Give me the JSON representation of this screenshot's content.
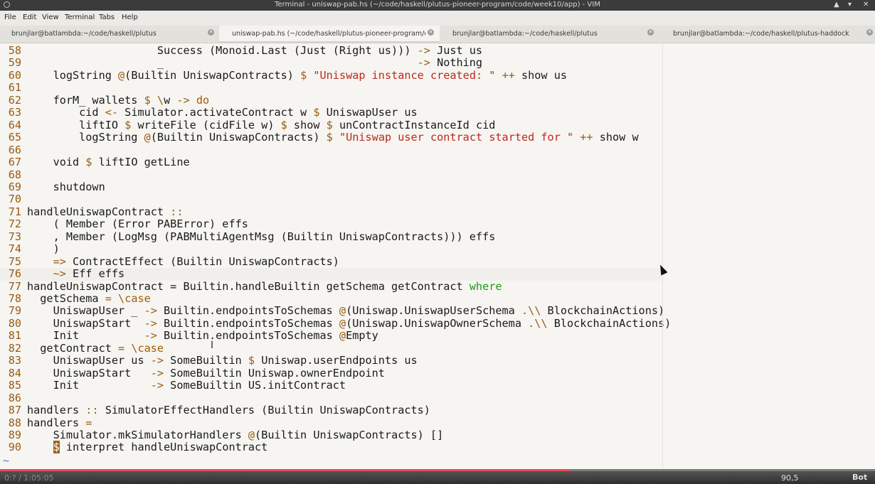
{
  "window": {
    "title": "Terminal - uniswap-pab.hs (~/code/haskell/plutus-pioneer-program/code/week10/app) - VIM",
    "controls": [
      "▲",
      "▾",
      "✕"
    ]
  },
  "menu": [
    "File",
    "Edit",
    "View",
    "Terminal",
    "Tabs",
    "Help"
  ],
  "tabs": [
    {
      "label": "brunjlar@batlambda:~/code/haskell/plutus"
    },
    {
      "label": "uniswap-pab.hs (~/code/haskell/plutus-pioneer-program/c..."
    },
    {
      "label": "brunjlar@batlambda:~/code/haskell/plutus"
    },
    {
      "label": "brunjlar@batlambda:~/code/haskell/plutus-haddock"
    }
  ],
  "editor": {
    "lines": [
      {
        "n": "58",
        "tokens": [
          [
            "",
            "                    Success (Monoid.Last (Just (Right us))) "
          ],
          [
            "op",
            "->"
          ],
          [
            "",
            " Just us"
          ]
        ]
      },
      {
        "n": "59",
        "tokens": [
          [
            "",
            "                    _                                       "
          ],
          [
            "op",
            "->"
          ],
          [
            "",
            " Nothing"
          ]
        ]
      },
      {
        "n": "60",
        "tokens": [
          [
            "",
            "    logString "
          ],
          [
            "op",
            "@"
          ],
          [
            "",
            "(Builtin UniswapContracts) "
          ],
          [
            "op",
            "$"
          ],
          [
            "",
            " "
          ],
          [
            "str",
            "\"Uniswap instance created: \""
          ],
          [
            "",
            " "
          ],
          [
            "op",
            "++"
          ],
          [
            "",
            " show us"
          ]
        ]
      },
      {
        "n": "61",
        "tokens": []
      },
      {
        "n": "62",
        "tokens": [
          [
            "",
            "    forM_ wallets "
          ],
          [
            "op",
            "$"
          ],
          [
            "",
            " "
          ],
          [
            "op",
            "\\"
          ],
          [
            "",
            "w "
          ],
          [
            "op",
            "->"
          ],
          [
            "",
            " "
          ],
          [
            "kw",
            "do"
          ]
        ]
      },
      {
        "n": "63",
        "tokens": [
          [
            "",
            "        cid "
          ],
          [
            "op",
            "<-"
          ],
          [
            "",
            " Simulator.activateContract w "
          ],
          [
            "op",
            "$"
          ],
          [
            "",
            " UniswapUser us"
          ]
        ]
      },
      {
        "n": "64",
        "tokens": [
          [
            "",
            "        liftIO "
          ],
          [
            "op",
            "$"
          ],
          [
            "",
            " writeFile (cidFile w) "
          ],
          [
            "op",
            "$"
          ],
          [
            "",
            " show "
          ],
          [
            "op",
            "$"
          ],
          [
            "",
            " unContractInstanceId cid"
          ]
        ]
      },
      {
        "n": "65",
        "tokens": [
          [
            "",
            "        logString "
          ],
          [
            "op",
            "@"
          ],
          [
            "",
            "(Builtin UniswapContracts) "
          ],
          [
            "op",
            "$"
          ],
          [
            "",
            " "
          ],
          [
            "str",
            "\"Uniswap user contract started for \""
          ],
          [
            "",
            " "
          ],
          [
            "op",
            "++"
          ],
          [
            "",
            " show w"
          ]
        ]
      },
      {
        "n": "66",
        "tokens": []
      },
      {
        "n": "67",
        "tokens": [
          [
            "",
            "    void "
          ],
          [
            "op",
            "$"
          ],
          [
            "",
            " liftIO getLine"
          ]
        ]
      },
      {
        "n": "68",
        "tokens": []
      },
      {
        "n": "69",
        "tokens": [
          [
            "",
            "    shutdown"
          ]
        ]
      },
      {
        "n": "70",
        "tokens": []
      },
      {
        "n": "71",
        "tokens": [
          [
            "",
            "handleUniswapContract "
          ],
          [
            "op",
            "::"
          ]
        ]
      },
      {
        "n": "72",
        "tokens": [
          [
            "",
            "    ( Member (Error PABError) effs"
          ]
        ]
      },
      {
        "n": "73",
        "tokens": [
          [
            "",
            "    , Member (LogMsg (PABMultiAgentMsg (Builtin UniswapContracts))) effs"
          ]
        ]
      },
      {
        "n": "74",
        "tokens": [
          [
            "",
            "    )"
          ]
        ]
      },
      {
        "n": "75",
        "tokens": [
          [
            "",
            "    "
          ],
          [
            "op",
            "=>"
          ],
          [
            "",
            " ContractEffect (Builtin UniswapContracts)"
          ]
        ]
      },
      {
        "n": "76",
        "tokens": [
          [
            "",
            "    "
          ],
          [
            "op",
            "~>"
          ],
          [
            "",
            " Eff effs"
          ]
        ],
        "current": true
      },
      {
        "n": "77",
        "tokens": [
          [
            "",
            "handleUniswapContract = Builtin.handleBuiltin getSchema getContract "
          ],
          [
            "where",
            "where"
          ]
        ]
      },
      {
        "n": "78",
        "tokens": [
          [
            "",
            "  getSchema "
          ],
          [
            "op",
            "="
          ],
          [
            "",
            " "
          ],
          [
            "op",
            "\\"
          ],
          [
            "kw",
            "case"
          ]
        ]
      },
      {
        "n": "79",
        "tokens": [
          [
            "",
            "    UniswapUser _ "
          ],
          [
            "op",
            "->"
          ],
          [
            "",
            " Builtin.endpointsToSchemas "
          ],
          [
            "op",
            "@"
          ],
          [
            "",
            "(Uniswap.UniswapUserSchema "
          ],
          [
            "op",
            ".\\\\"
          ],
          [
            "",
            " BlockchainActions)"
          ]
        ]
      },
      {
        "n": "80",
        "tokens": [
          [
            "",
            "    UniswapStart  "
          ],
          [
            "op",
            "->"
          ],
          [
            "",
            " Builtin.endpointsToSchemas "
          ],
          [
            "op",
            "@"
          ],
          [
            "",
            "(Uniswap.UniswapOwnerSchema "
          ],
          [
            "op",
            ".\\\\"
          ],
          [
            "",
            " BlockchainActions)"
          ]
        ]
      },
      {
        "n": "81",
        "tokens": [
          [
            "",
            "    Init          "
          ],
          [
            "op",
            "->"
          ],
          [
            "",
            " Builtin.endpointsToSchemas "
          ],
          [
            "op",
            "@"
          ],
          [
            "",
            "Empty"
          ]
        ]
      },
      {
        "n": "82",
        "tokens": [
          [
            "",
            "  getContract "
          ],
          [
            "op",
            "="
          ],
          [
            "",
            " "
          ],
          [
            "op",
            "\\"
          ],
          [
            "kw",
            "case"
          ]
        ]
      },
      {
        "n": "83",
        "tokens": [
          [
            "",
            "    UniswapUser us "
          ],
          [
            "op",
            "->"
          ],
          [
            "",
            " SomeBuiltin "
          ],
          [
            "op",
            "$"
          ],
          [
            "",
            " Uniswap.userEndpoints us"
          ]
        ]
      },
      {
        "n": "84",
        "tokens": [
          [
            "",
            "    UniswapStart   "
          ],
          [
            "op",
            "->"
          ],
          [
            "",
            " SomeBuiltin Uniswap.ownerEndpoint"
          ]
        ]
      },
      {
        "n": "85",
        "tokens": [
          [
            "",
            "    Init           "
          ],
          [
            "op",
            "->"
          ],
          [
            "",
            " SomeBuiltin US.initContract"
          ]
        ]
      },
      {
        "n": "86",
        "tokens": []
      },
      {
        "n": "87",
        "tokens": [
          [
            "",
            "handlers "
          ],
          [
            "op",
            "::"
          ],
          [
            "",
            " SimulatorEffectHandlers (Builtin UniswapContracts)"
          ]
        ]
      },
      {
        "n": "88",
        "tokens": [
          [
            "",
            "handlers "
          ],
          [
            "op",
            "="
          ]
        ]
      },
      {
        "n": "89",
        "tokens": [
          [
            "",
            "    Simulator.mkSimulatorHandlers "
          ],
          [
            "op",
            "@"
          ],
          [
            "",
            "(Builtin UniswapContracts) []"
          ]
        ]
      },
      {
        "n": "90",
        "tokens": [
          [
            "",
            "    "
          ],
          [
            "cursor",
            "$"
          ],
          [
            "",
            " interpret handleUniswapContract"
          ]
        ]
      }
    ],
    "tilde": "~"
  },
  "status": {
    "time": "0:? / 1:05:05",
    "position": "90,5",
    "scroll": "Bot",
    "video_progress": 0.652
  }
}
